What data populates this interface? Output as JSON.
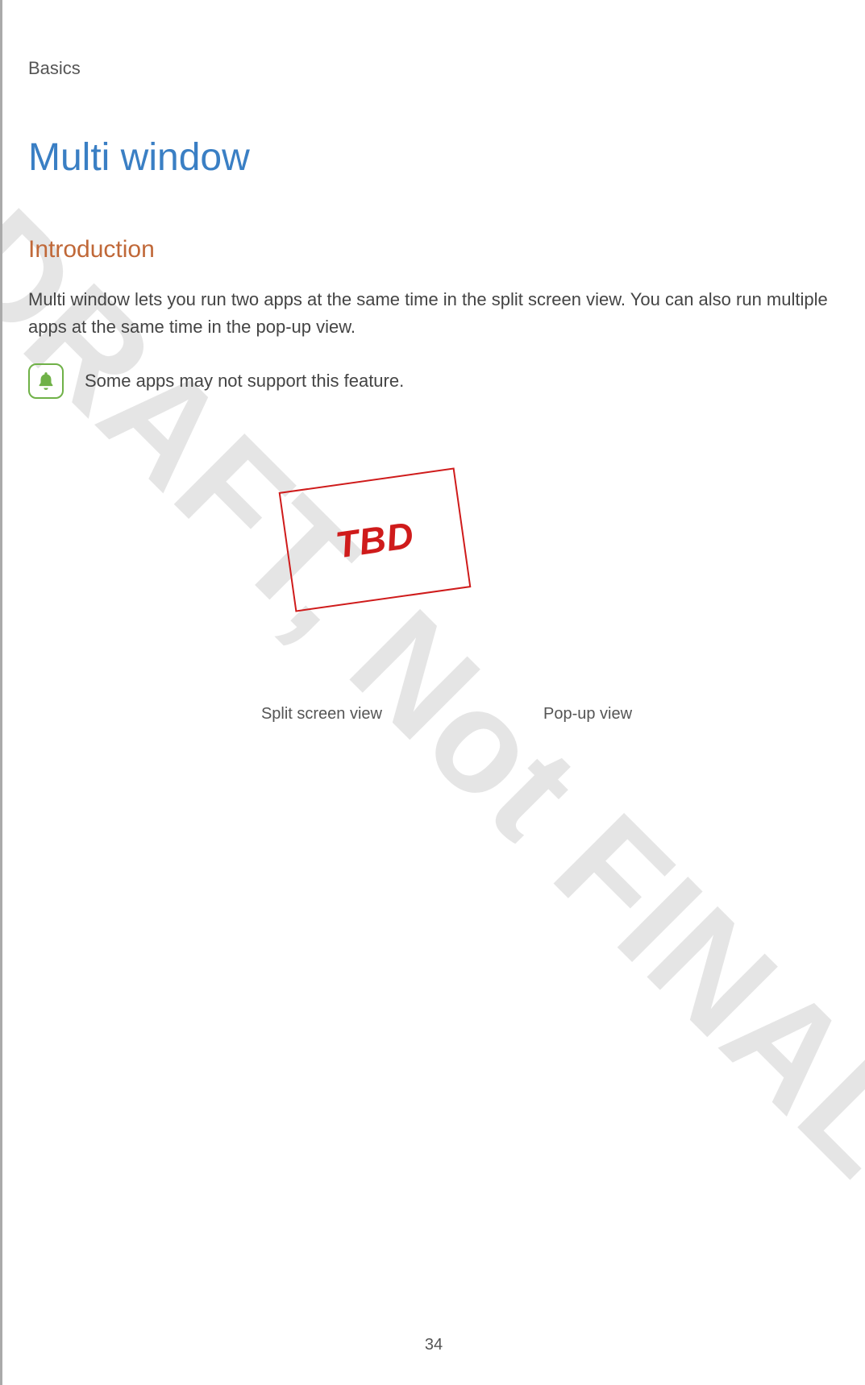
{
  "header": {
    "section": "Basics"
  },
  "title": "Multi window",
  "subtitle": "Introduction",
  "body": "Multi window lets you run two apps at the same time in the split screen view. You can also run multiple apps at the same time in the pop-up view.",
  "note": {
    "text": "Some apps may not support this feature."
  },
  "tbd": "TBD",
  "captions": {
    "left": "Split screen view",
    "right": "Pop-up view"
  },
  "watermark": "DRAFT, Not FINAL",
  "page_number": "34"
}
